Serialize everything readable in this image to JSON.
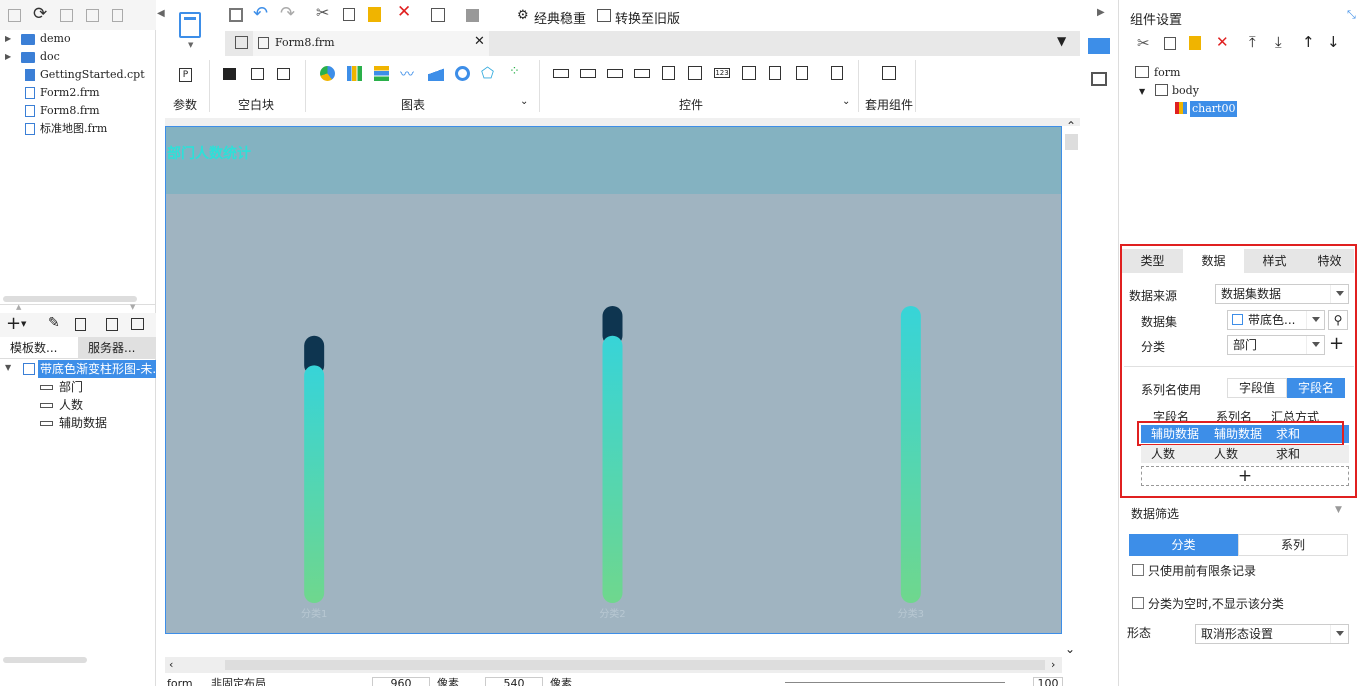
{
  "left_panel": {
    "tree": [
      "demo",
      "doc",
      "GettingStarted.cpt",
      "Form2.frm",
      "Form8.frm",
      "标准地图.frm"
    ],
    "tabs": [
      "模板数...",
      "服务器..."
    ],
    "dataset": {
      "name": "带底色渐变柱形图-未...",
      "fields": [
        "部门",
        "人数",
        "辅助数据"
      ]
    }
  },
  "toolbar": {
    "classic": "经典稳重",
    "convert": "转换至旧版"
  },
  "file_tab": "Form8.frm",
  "ribbon": {
    "param": "参数",
    "blank": "空白块",
    "chart": "图表",
    "widget": "控件",
    "suite": "套用组件"
  },
  "chart": {
    "title": "部门人数统计",
    "chart_data": {
      "type": "bar",
      "categories": [
        "分类1",
        "分类2",
        "分类3"
      ],
      "series": [
        {
          "name": "人数",
          "values": [
            80,
            90,
            100
          ]
        },
        {
          "name": "辅助数据",
          "values": [
            10,
            10,
            0
          ]
        }
      ],
      "colors": {
        "top": "#0e3550",
        "grad_top": "#37d4d8",
        "grad_bottom": "#6fd78d",
        "background": "#a0b4c1",
        "header": "#84b2c1"
      }
    }
  },
  "status": {
    "form": "form",
    "layout": "非固定布局",
    "width": "960",
    "unit": "像素",
    "height": "540",
    "unit2": "像素",
    "zoom": "100"
  },
  "right_panel": {
    "title": "组件设置",
    "tree": {
      "form": "form",
      "body": "body",
      "chart": "chart00"
    },
    "tabs": [
      "类型",
      "数据",
      "样式",
      "特效"
    ],
    "data_source_label": "数据来源",
    "data_source": "数据集数据",
    "dataset_label": "数据集",
    "dataset": "带底色...",
    "category_label": "分类",
    "category": "部门",
    "series_name_label": "系列名使用",
    "series_opt1": "字段值",
    "series_opt2": "字段名",
    "table_headers": [
      "字段名",
      "系列名",
      "汇总方式"
    ],
    "rows": [
      [
        "辅助数据",
        "辅助数据",
        "求和"
      ],
      [
        "人数",
        "人数",
        "求和"
      ]
    ],
    "filter_label": "数据筛选",
    "filter_tab1": "分类",
    "filter_tab2": "系列",
    "check1": "只使用前有限条记录",
    "check2": "分类为空时,不显示该分类",
    "form_label": "形态",
    "form_value": "取消形态设置"
  }
}
